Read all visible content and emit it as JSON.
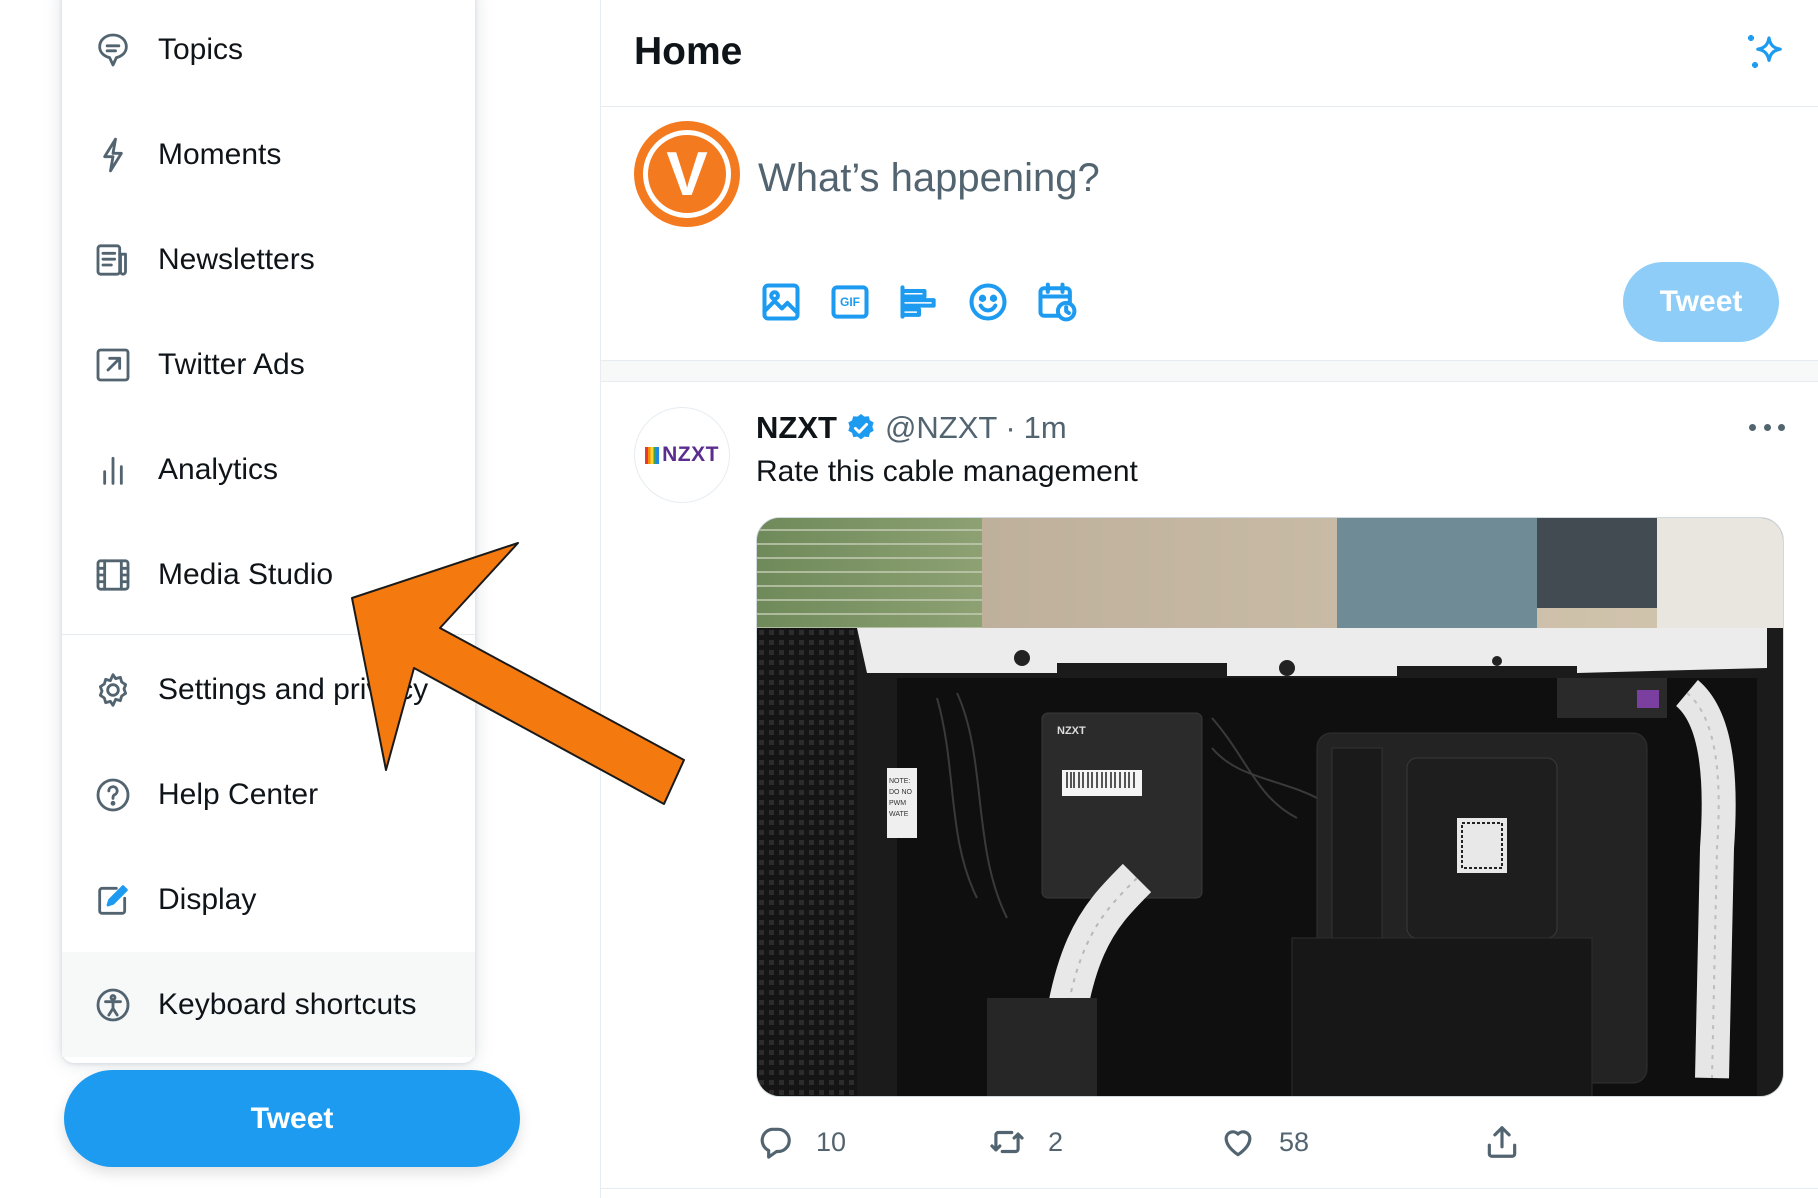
{
  "menu": {
    "items": [
      {
        "label": "Topics",
        "icon": "topics-icon"
      },
      {
        "label": "Moments",
        "icon": "lightning-icon"
      },
      {
        "label": "Newsletters",
        "icon": "newsletter-icon"
      },
      {
        "label": "Twitter Ads",
        "icon": "external-arrow-icon"
      },
      {
        "label": "Analytics",
        "icon": "bar-chart-icon"
      },
      {
        "label": "Media Studio",
        "icon": "film-icon"
      },
      {
        "label": "Settings and privacy",
        "icon": "gear-icon"
      },
      {
        "label": "Help Center",
        "icon": "help-circle-icon"
      },
      {
        "label": "Display",
        "icon": "display-edit-icon"
      },
      {
        "label": "Keyboard shortcuts",
        "icon": "accessibility-icon"
      }
    ]
  },
  "sidebar": {
    "tweet_button_label": "Tweet"
  },
  "header": {
    "title": "Home",
    "icon": "sparkle-icon"
  },
  "compose": {
    "avatar_letter": "V",
    "placeholder": "What’s happening?",
    "tools": [
      "image-icon",
      "gif-icon",
      "poll-icon",
      "emoji-icon",
      "schedule-icon"
    ],
    "gif_label": "GIF",
    "tweet_button_label": "Tweet"
  },
  "tweet": {
    "avatar_text": "NZXT",
    "name": "NZXT",
    "handle": "@NZXT",
    "separator": "·",
    "time": "1m",
    "text": "Rate this cable management",
    "media_labels": {
      "case_brand": "NZXT",
      "note_lines": [
        "NOTE:",
        "DO NO",
        "PWM",
        "WATE"
      ]
    },
    "actions": {
      "replies": "10",
      "retweets": "2",
      "likes": "58"
    }
  },
  "colors": {
    "accent": "#1d9bf0",
    "accent_disabled": "#8ecdf8",
    "annotation_arrow": "#f47a10",
    "avatar_orange": "#f47a20"
  }
}
